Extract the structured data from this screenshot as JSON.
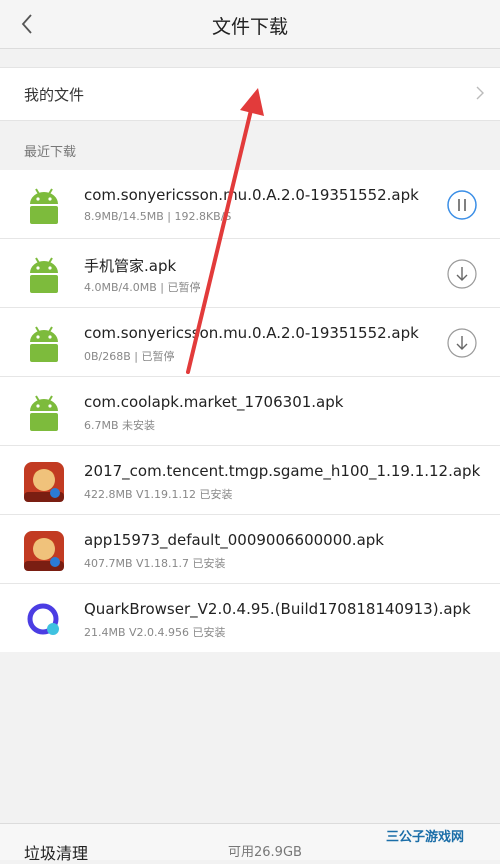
{
  "header": {
    "title": "文件下载"
  },
  "my_files": {
    "label": "我的文件"
  },
  "section": {
    "label": "最近下载"
  },
  "downloads": [
    {
      "name": "com.sonyericsson.mu.0.A.2.0-19351552.apk",
      "meta": "8.9MB/14.5MB | 192.8KB/S",
      "icon": "android-icon",
      "action": "pause-icon"
    },
    {
      "name": "手机管家.apk",
      "meta": "4.0MB/4.0MB | 已暂停",
      "icon": "android-icon",
      "action": "download-icon"
    },
    {
      "name": "com.sonyericsson.mu.0.A.2.0-19351552.apk",
      "meta": "0B/268B | 已暂停",
      "icon": "android-icon",
      "action": "download-icon"
    },
    {
      "name": "com.coolapk.market_1706301.apk",
      "meta": "6.7MB  未安装",
      "icon": "android-icon",
      "action": ""
    },
    {
      "name": "2017_com.tencent.tmgp.sgame_h100_1.19.1.12.apk",
      "meta": "422.8MB  V1.19.1.12 已安装",
      "icon": "game-icon",
      "action": ""
    },
    {
      "name": "app15973_default_0009006600000.apk",
      "meta": "407.7MB  V1.18.1.7 已安装",
      "icon": "game-icon",
      "action": ""
    },
    {
      "name": "QuarkBrowser_V2.0.4.95.(Build170818140913).apk",
      "meta": "21.4MB  V2.0.4.956 已安装",
      "icon": "quark-icon",
      "action": ""
    }
  ],
  "bottom": {
    "clean_label": "垃圾清理",
    "available": "可用26.9GB"
  },
  "watermark": {
    "text": "三公子游戏网"
  },
  "colors": {
    "android": "#7dbb3c",
    "accent_blue": "#3a8ee6",
    "arrow": "#e23b3b"
  }
}
